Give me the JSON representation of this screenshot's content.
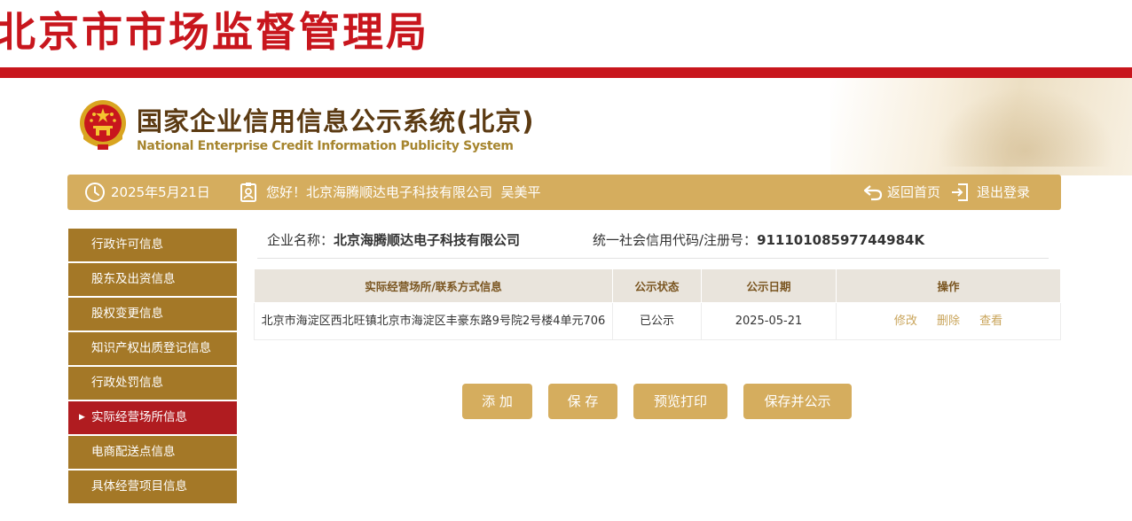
{
  "banner": {
    "title": "北京市市场监督管理局"
  },
  "system": {
    "title_cn": "国家企业信用信息公示系统(北京)",
    "title_en": "National Enterprise Credit Information Publicity System"
  },
  "info_bar": {
    "date": "2025年5月21日",
    "greeting": "您好！北京海腾顺达电子科技有限公司  吴美平",
    "home_label": "返回首页",
    "logout_label": "退出登录"
  },
  "sidebar": {
    "items": [
      {
        "label": "行政许可信息",
        "active": false
      },
      {
        "label": "股东及出资信息",
        "active": false
      },
      {
        "label": "股权变更信息",
        "active": false
      },
      {
        "label": "知识产权出质登记信息",
        "active": false
      },
      {
        "label": "行政处罚信息",
        "active": false
      },
      {
        "label": "实际经营场所信息",
        "active": true
      },
      {
        "label": "电商配送点信息",
        "active": false
      },
      {
        "label": "具体经营项目信息",
        "active": false
      }
    ]
  },
  "company": {
    "name_label": "企业名称：",
    "name": "北京海腾顺达电子科技有限公司",
    "code_label": "统一社会信用代码/注册号：",
    "code": "91110108597744984K"
  },
  "table": {
    "headers": [
      "实际经营场所/联系方式信息",
      "公示状态",
      "公示日期",
      "操作"
    ],
    "rows": [
      {
        "address": "北京市海淀区西北旺镇北京市海淀区丰豪东路9号院2号楼4单元706",
        "status": "已公示",
        "date": "2025-05-21",
        "ops": [
          "修改",
          "删除",
          "查看"
        ]
      }
    ]
  },
  "buttons": {
    "add": "添 加",
    "save": "保 存",
    "preview_print": "预览打印",
    "save_publish": "保存并公示"
  },
  "colors": {
    "brand_red": "#c8161d",
    "gold": "#d5ad5e",
    "sidebar_brown": "#a47827",
    "sidebar_active": "#b01c20"
  }
}
